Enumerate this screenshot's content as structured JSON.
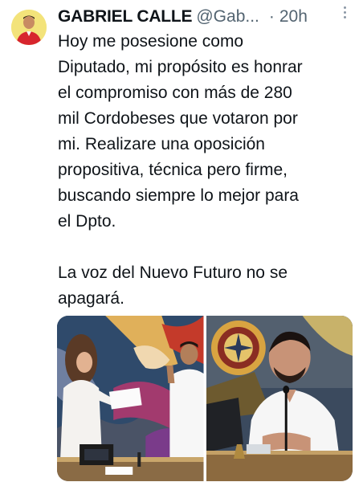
{
  "tweet": {
    "display_name": "GABRIEL CALLE",
    "handle": "@Gab...",
    "separator": "·",
    "time": "20h",
    "text": "Hoy me posesione como\nDiputado, mi propósito es honrar\nel compromiso con más de 280\nmil Cordobeses que votaron por\nmi. Realizare una oposición\npropositiva, técnica pero firme,\nbuscando siempre lo mejor para\nel Dpto.\n\nLa voz del Nuevo Futuro no se\napagará.",
    "media": [
      {
        "name": "swearing-in-photo"
      },
      {
        "name": "speaking-at-desk-photo"
      }
    ]
  },
  "colors": {
    "text": "#0f1419",
    "secondary": "#536471",
    "avatar_bg": "#f3e37a"
  },
  "icons": {
    "more": "more-dots-icon"
  }
}
